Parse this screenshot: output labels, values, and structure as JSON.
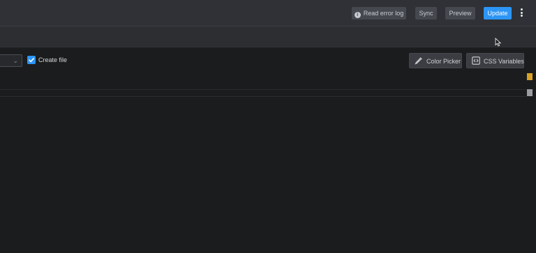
{
  "header": {
    "read_error_log_label": "Read error log",
    "sync_label": "Sync",
    "preview_label": "Preview",
    "update_label": "Update"
  },
  "toolbar": {
    "create_file_label": "Create file",
    "create_file_checked": true,
    "color_picker_label": "Color Picker",
    "css_variables_label": "CSS Variables"
  },
  "icons": {
    "info": "info-icon",
    "more": "more-vertical-icon",
    "dropdown": "chevron-down-icon",
    "check": "check-icon",
    "eyedropper": "eyedropper-icon",
    "code": "code-brackets-icon",
    "cursor": "mouse-pointer-icon"
  },
  "colors": {
    "accent": "#2d95f5",
    "topbar_bg": "#2f3136",
    "editor_bg": "#1b1c1d",
    "marker_warning": "#d9a226",
    "marker_neutral": "#9a9ca0"
  }
}
